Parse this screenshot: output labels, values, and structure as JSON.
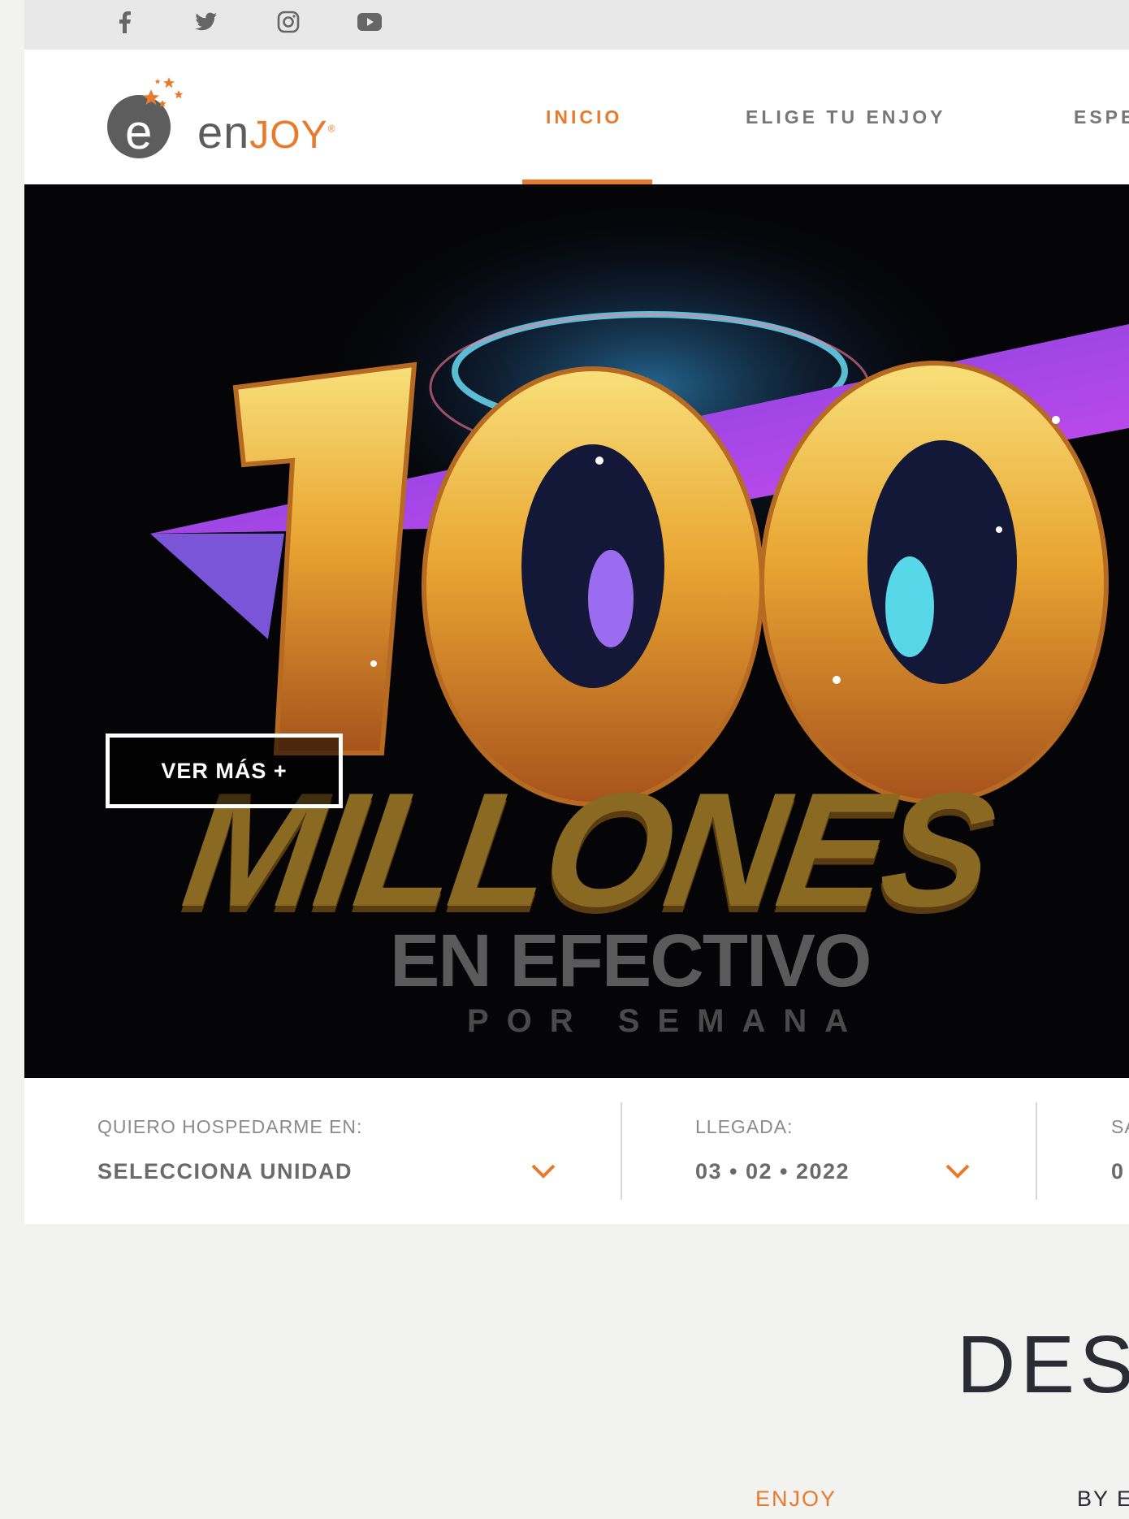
{
  "social": {
    "items": [
      {
        "name": "facebook-icon",
        "glyph": "f"
      },
      {
        "name": "twitter-icon"
      },
      {
        "name": "instagram-icon"
      },
      {
        "name": "youtube-icon"
      }
    ]
  },
  "header": {
    "logo": {
      "text_en": "en",
      "text_joy": "JOY",
      "registered": "®"
    },
    "nav": [
      {
        "label": "INICIO",
        "active": true
      },
      {
        "label": "ELIGE TU ENJOY",
        "active": false
      },
      {
        "label": "ESPE",
        "active": false
      }
    ]
  },
  "hero": {
    "number": "100",
    "line1": "MILLONES",
    "line2": "EN EFECTIVO",
    "line3": "POR SEMANA",
    "cta": "VER MÁS +"
  },
  "booking": {
    "fields": [
      {
        "label": "QUIERO HOSPEDARME EN:",
        "value": "SELECCIONA UNIDAD"
      },
      {
        "label": "LLEGADA:",
        "value": "03 • 02 • 2022"
      },
      {
        "label": "SA",
        "value": "0"
      }
    ]
  },
  "section": {
    "title": "DES",
    "tabs": [
      {
        "label": "ENJOY",
        "active": true
      },
      {
        "label": "BY E",
        "active": false
      }
    ]
  },
  "colors": {
    "accent": "#e87a2c",
    "text_dark": "#2b2b33",
    "text_gray": "#777777"
  }
}
